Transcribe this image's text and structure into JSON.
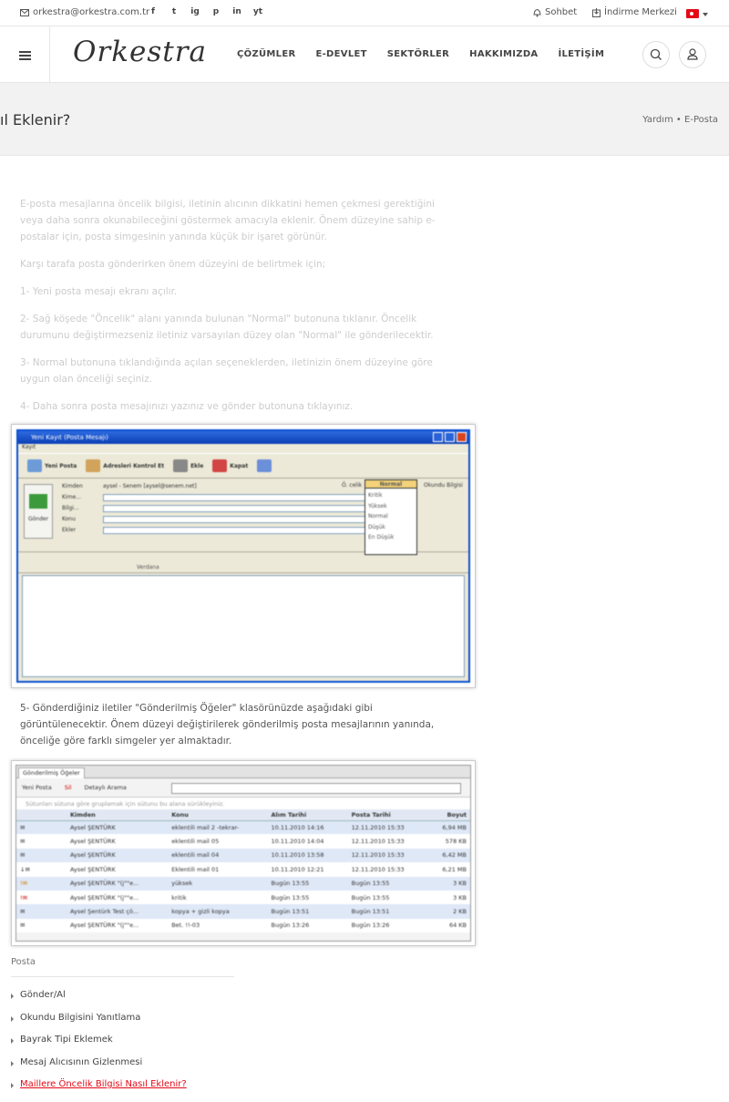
{
  "topbar": {
    "email": "orkestra@orkestra.com.tr",
    "socials": [
      "f",
      "t",
      "ig",
      "p",
      "in",
      "yt"
    ],
    "chat_label": "Sohbet",
    "download_label": "İndirme Merkezi",
    "language": "TR"
  },
  "header": {
    "logo": "Orkestra",
    "nav": [
      "ÇÖZÜMLER",
      "E-DEVLET",
      "SEKTÖRLER",
      "HAKKIMIZDA",
      "İLETİŞİM"
    ]
  },
  "page": {
    "title": "ıl Eklenir?",
    "breadcrumb": "Yardım • E-Posta"
  },
  "article": {
    "intro": "E-posta mesajlarına öncelik bilgisi, iletinin alıcının dikkatini hemen çekmesi gerektiğini veya daha sonra okunabileceğini göstermek amacıyla eklenir. Önem düzeyine sahip e-postalar için, posta simgesinin yanında küçük bir işaret görünür.",
    "lead": "Karşı tarafa posta gönderirken önem düzeyini de belirtmek için;",
    "step1": "1- Yeni posta mesajı ekranı açılır.",
    "step2": "2- Sağ köşede \"Öncelik\" alanı yanında bulunan \"Normal\" butonuna tıklanır. Öncelik durumunu değiştirmezseniz iletiniz varsayılan düzey olan \"Normal\" ile gönderilecektir.",
    "step3": "3- Normal butonuna tıklandığında açılan seçeneklerden, iletinizin önem düzeyine göre uygun olan önceliği seçiniz.",
    "step4": "4- Daha sonra posta mesajınızı yazınız ve gönder butonuna tıklayınız.",
    "step5": "5- Gönderdiğiniz iletiler \"Gönderilmiş Öğeler\" klasörünüzde aşağıdaki gibi görüntülenecektir. Önem düzeyi değiştirilerek gönderilmiş posta mesajlarının yanında, önceliğe göre farklı simgeler yer almaktadır."
  },
  "screenshot1": {
    "title": "Yeni Kayıt (Posta Mesajı)",
    "menu": "Kayıt",
    "toolbar": [
      "Yeni Posta",
      "Adresleri Kontrol Et",
      "Ekle",
      "Kapat"
    ],
    "send": "Gönder",
    "fields": [
      "Kimden",
      "Kime...",
      "Bilgi...",
      "Konu",
      "Ekler"
    ],
    "from_value": "aysel - Senem [aysel@senem.net]",
    "priority_label": "Ö. celik",
    "priority_value": "Normal",
    "read_receipt": "Okundu Bilgisi",
    "priority_options": [
      "Kritik",
      "Yüksek",
      "Normal",
      "Düşük",
      "En Düşük"
    ],
    "font": "Verdana"
  },
  "screenshot2": {
    "tab": "Gönderilmiş Öğeler",
    "toolbar": [
      "Yeni Posta",
      "Sil",
      "Detaylı Arama"
    ],
    "group_hint": "Sütunları sütuna göre gruplamak için sütunu bu alana sürükleyiniz.",
    "columns": [
      "Kimden",
      "Konu",
      "Alım Tarihi",
      "Posta Tarihi",
      "Boyut"
    ],
    "rows": [
      [
        "Aysel ŞENTÜRK",
        "eklentili mail 2 -tekrar-",
        "10.11.2010 14:16",
        "12.11.2010 15:33",
        "6,94 MB"
      ],
      [
        "Aysel ŞENTÜRK",
        "eklentili mail 05",
        "10.11.2010 14:04",
        "12.11.2010 15:33",
        "578 KB"
      ],
      [
        "Aysel ŞENTÜRK",
        "eklentili mail 04",
        "10.11.2010 13:58",
        "12.11.2010 15:33",
        "6,42 MB"
      ],
      [
        "Aysel ŞENTÜRK",
        "Eklentili mail 01",
        "10.11.2010 12:21",
        "12.11.2010 15:33",
        "6,21 MB"
      ],
      [
        "Aysel ŞENTÜRK \"(j\"\"e...",
        "yüksek",
        "Bugün 13:55",
        "Bugün 13:55",
        "3 KB"
      ],
      [
        "Aysel ŞENTÜRK \"(j\"\"e...",
        "kritik",
        "Bugün 13:55",
        "Bugün 13:55",
        "3 KB"
      ],
      [
        "Aysel Şentürk Test çö...",
        "kopya + gizli kopya",
        "Bugün 13:51",
        "Bugün 13:51",
        "2 KB"
      ],
      [
        "Aysel ŞENTÜRK \"(j\"\"e...",
        "Bet. !!-03",
        "Bugün 13:26",
        "Bugün 13:26",
        "64 KB"
      ]
    ]
  },
  "sidebar": {
    "heading": "Posta",
    "items": [
      "Gönder/Al",
      "Okundu Bilgisini Yanıtlama",
      "Bayrak Tipi Eklemek",
      "Mesaj Alıcısının Gizlenmesi",
      "Maillere Öncelik Bilgisi Nasıl Eklenir?"
    ]
  }
}
